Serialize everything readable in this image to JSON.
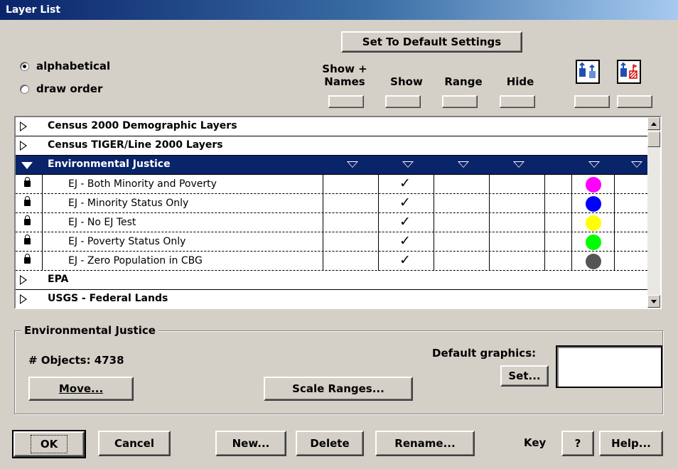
{
  "window": {
    "title": "Layer List"
  },
  "toolbar": {
    "default_settings": "Set To Default Settings"
  },
  "sort": {
    "options": [
      {
        "label": "alphabetical",
        "selected": true
      },
      {
        "label": "draw order",
        "selected": false
      }
    ]
  },
  "columns": {
    "show_names_line1": "Show +",
    "show_names_line2": "Names",
    "show": "Show",
    "range": "Range",
    "hide": "Hide"
  },
  "icons": [
    "layer-up-icon",
    "layer-hatch-icon"
  ],
  "list": {
    "groups": [
      {
        "label": "Census 2000 Demographic Layers",
        "expanded": false
      },
      {
        "label": "Census TIGER/Line 2000 Layers",
        "expanded": false
      },
      {
        "label": "Environmental Justice",
        "expanded": true,
        "selected": true
      },
      {
        "label": "EPA",
        "expanded": false
      },
      {
        "label": "USGS - Federal Lands",
        "expanded": false
      }
    ],
    "layers": [
      {
        "label": "EJ - Both Minority and Poverty",
        "show": true,
        "color": "#ff00ff"
      },
      {
        "label": "EJ - Minority Status Only",
        "show": true,
        "color": "#0000ff"
      },
      {
        "label": "EJ - No EJ Test",
        "show": true,
        "color": "#ffff00"
      },
      {
        "label": "EJ - Poverty Status Only",
        "show": true,
        "color": "#00ff00"
      },
      {
        "label": "EJ - Zero Population in CBG",
        "show": true,
        "color": "#555555"
      }
    ],
    "check_mark": "✓"
  },
  "details": {
    "group_title": "Environmental Justice",
    "objects_label": "# Objects: 4738",
    "move": "Move...",
    "scale_ranges": "Scale Ranges...",
    "default_graphics": "Default graphics:",
    "set": "Set..."
  },
  "footer": {
    "ok": "OK",
    "cancel": "Cancel",
    "new": "New...",
    "delete": "Delete",
    "rename": "Rename...",
    "key": "Key",
    "help_q": "?",
    "help": "Help..."
  }
}
